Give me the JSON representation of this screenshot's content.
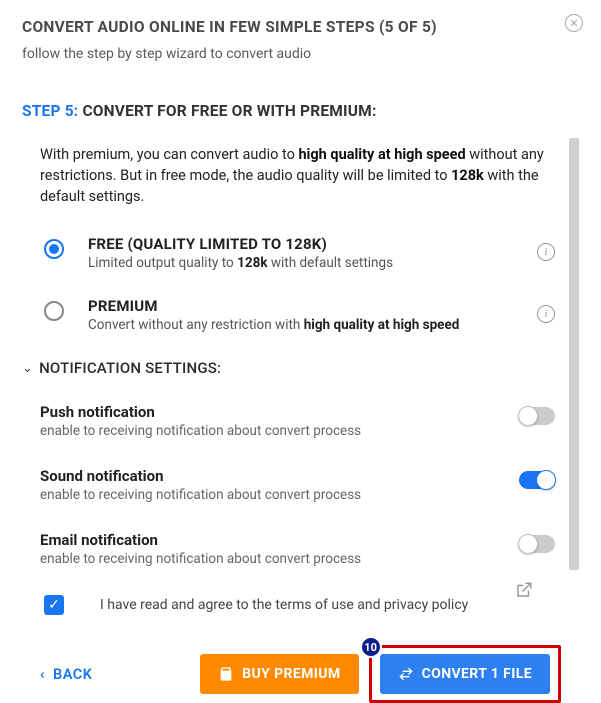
{
  "header": {
    "title": "CONVERT AUDIO ONLINE IN FEW SIMPLE STEPS (5 OF 5)",
    "subtitle": "follow the step by step wizard to convert audio"
  },
  "step": {
    "num": "STEP 5:",
    "label": "CONVERT FOR FREE OR WITH PREMIUM:"
  },
  "description": {
    "pre": "With premium, you can convert audio to ",
    "bold1": "high quality at high speed",
    "mid": " without any restrictions. But in free mode, the audio quality will be limited to ",
    "bold2": "128k",
    "post": " with the default settings."
  },
  "options": {
    "free": {
      "title": "FREE (QUALITY LIMITED TO 128K)",
      "sub_pre": "Limited output quality to ",
      "sub_bold": "128k",
      "sub_post": " with default settings"
    },
    "premium": {
      "title": "PREMIUM",
      "sub_pre": "Convert without any restriction with ",
      "sub_bold": "high quality at high speed",
      "sub_post": ""
    }
  },
  "notifications": {
    "heading": "NOTIFICATION SETTINGS:",
    "push": {
      "title": "Push notification",
      "sub": "enable to receiving notification about convert process"
    },
    "sound": {
      "title": "Sound notification",
      "sub": "enable to receiving notification about convert process"
    },
    "email": {
      "title": "Email notification",
      "sub": "enable to receiving notification about convert process"
    }
  },
  "agree": {
    "text": "I have read and agree to the terms of use and privacy policy"
  },
  "footer": {
    "back": "BACK",
    "buy": "BUY PREMIUM",
    "convert": "CONVERT 1 FILE",
    "badge": "10"
  }
}
